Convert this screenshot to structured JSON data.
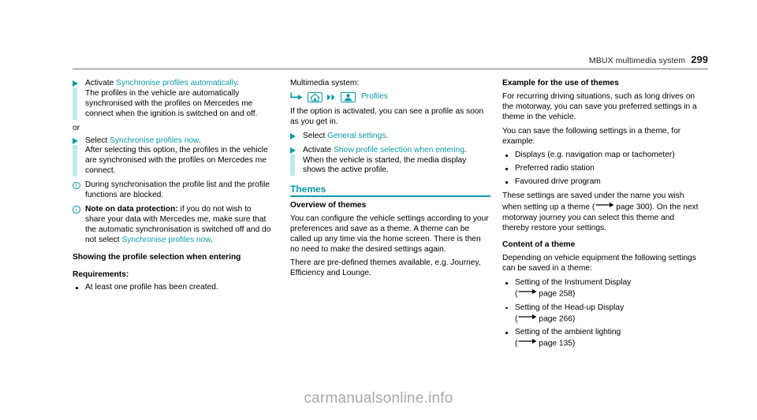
{
  "header": {
    "title": "MBUX multimedia system",
    "page_number": "299"
  },
  "colors": {
    "teal": "#0a9aa6",
    "teal_bar": "#bfeaec",
    "rule_gray": "#6d6e71",
    "watermark": "#a7a9ac"
  },
  "column_left": {
    "step_activate": {
      "lead": "Activate ",
      "option": "Synchronise profiles automatically",
      "after_option": ".",
      "body": "The profiles in the vehicle are automatically synchronised with the profiles on Mercedes me connect when the ignition is switched on and off."
    },
    "or_label": "or",
    "step_select": {
      "lead": "Select ",
      "option": "Synchronise profiles now",
      "after_option": ".",
      "body": "After selecting this option, the profiles in the vehicle are synchronised with the profiles on Mercedes me connect."
    },
    "note_sync": "During synchronisation the profile list and the profile functions are blocked.",
    "note_data": {
      "bold_lead": "Note on data protection:",
      "text_before": " if you do not wish to share your data with Mercedes me, make sure that the automatic synchronisation is switched off and do not select ",
      "option": "Synchronise profiles now",
      "text_after": "."
    },
    "heading_showing": "Showing the profile selection when entering",
    "heading_requirements": "Requirements:",
    "requirements": [
      "At least one profile has been created."
    ]
  },
  "column_middle": {
    "multimedia_label": "Multimedia system:",
    "path": {
      "arrow_icon": "hooked-arrow-icon",
      "home_icon": "home-icon",
      "chevron_icon": "double-chevron-icon",
      "profile_icon": "person-icon",
      "label": "Profiles"
    },
    "intro": "If the option is activated, you can see a profile as soon as you get in.",
    "step_general": {
      "lead": "Select ",
      "option": "General settings",
      "after_option": "."
    },
    "step_show": {
      "lead": "Activate ",
      "option": "Show profile selection when entering",
      "after_option": ".",
      "body": "When the vehicle is started, the media display shows the active profile."
    },
    "themes_heading": "Themes",
    "overview_heading": "Overview of themes",
    "overview_body": "You can configure the vehicle settings according to your preferences and save as a theme. A theme can be called up any time via the home screen. There is then no need to make the desired settings again.",
    "predefined_body": "There are pre-defined themes available, e.g. Journey, Efficiency and Lounge."
  },
  "column_right": {
    "example_heading": "Example for the use of themes",
    "example_body": "For recurring driving situations, such as long drives on the motorway, you can save you preferred settings in a theme in the vehicle.",
    "save_intro": "You can save the following settings in a theme, for example:",
    "save_list": [
      "Displays (e.g. navigation map or tachometer)",
      "Preferred radio station",
      "Favoured drive program"
    ],
    "saved_under": {
      "text_before": "These settings are saved under the name you wish when setting up a theme (",
      "page_ref": "page 300",
      "text_after": "). On the next motorway journey you can select this theme and thereby restore your settings."
    },
    "content_heading": "Content of a theme",
    "content_intro": "Depending on vehicle equipment the following settings can be saved in a theme:",
    "content_list": [
      {
        "label": "Setting of the Instrument Display",
        "page_ref": "page 258"
      },
      {
        "label": "Setting of the Head-up Display",
        "page_ref": "page 266"
      },
      {
        "label": "Setting of the ambient lighting",
        "page_ref": "page 135"
      }
    ]
  },
  "watermark": {
    "text": "carmanualsonline.info"
  }
}
